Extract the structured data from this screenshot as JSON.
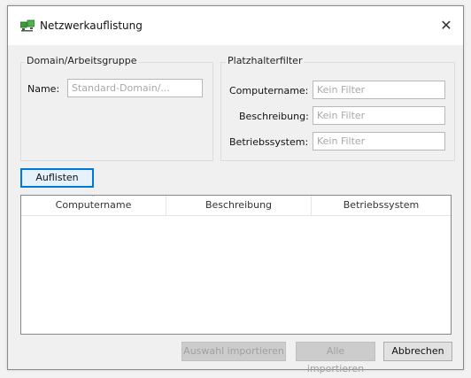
{
  "window": {
    "title": "Netzwerkauflistung",
    "close_glyph": "✕",
    "icon": "network-computers-icon"
  },
  "domain_group": {
    "title": "Domain/Arbeitsgruppe",
    "name_label": "Name:",
    "name_placeholder": "Standard-Domain/..."
  },
  "filter_group": {
    "title": "Platzhalterfilter",
    "computer_label": "Computername:",
    "computer_placeholder": "Kein Filter",
    "description_label": "Beschreibung:",
    "description_placeholder": "Kein Filter",
    "os_label": "Betriebssystem:",
    "os_placeholder": "Kein Filter"
  },
  "list_button": "Auflisten",
  "table": {
    "columns": [
      "Computername",
      "Beschreibung",
      "Betriebssystem"
    ],
    "rows": []
  },
  "footer": {
    "import_selected": "Auswahl importieren",
    "import_all": "Alle importieren",
    "cancel": "Abbrechen"
  },
  "colors": {
    "accent": "#0078d7",
    "icon_green": "#3a9c3a"
  }
}
